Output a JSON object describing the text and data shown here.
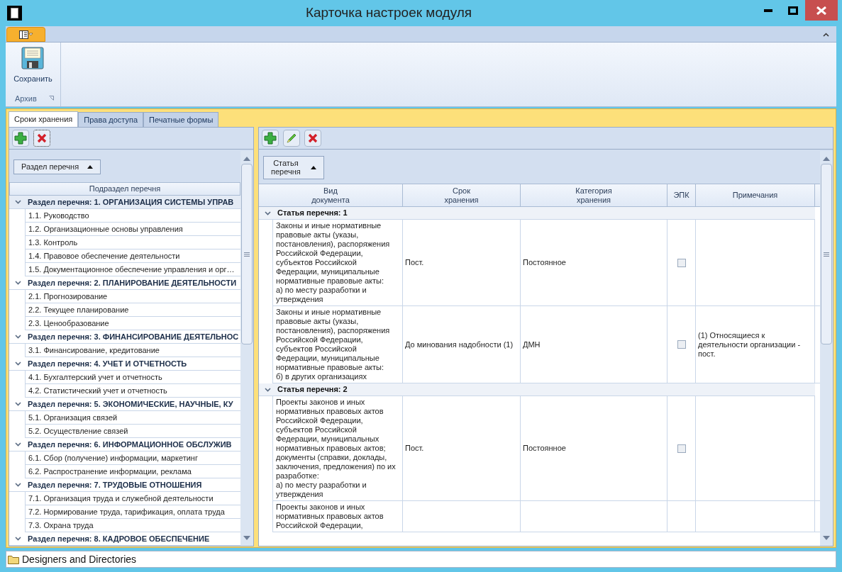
{
  "window": {
    "title": "Карточка настроек модуля"
  },
  "ribbon": {
    "groups": [
      {
        "label": "Архив",
        "buttons": [
          {
            "label": "Сохранить"
          }
        ]
      }
    ]
  },
  "tabs": [
    {
      "label": "Сроки хранения",
      "selected": true
    },
    {
      "label": "Права доступа",
      "selected": false
    },
    {
      "label": "Печатные формы",
      "selected": false
    }
  ],
  "left_panel": {
    "group_by": "Раздел перечня",
    "column": "Подраздел перечня",
    "groups": [
      {
        "label": "Раздел перечня: 1. ОРГАНИЗАЦИЯ СИСТЕМЫ УПРАВ",
        "expanded": true,
        "children": [
          {
            "label": "1.1. Руководство"
          },
          {
            "label": "1.2. Организационные основы управления"
          },
          {
            "label": "1.3. Контроль"
          },
          {
            "label": "1.4. Правовое обеспечение деятельности"
          },
          {
            "label": "1.5. Документационное обеспечение управления и орг…"
          }
        ]
      },
      {
        "label": "Раздел перечня: 2. ПЛАНИРОВАНИЕ ДЕЯТЕЛЬНОСТИ",
        "expanded": true,
        "children": [
          {
            "label": "2.1. Прогнозирование"
          },
          {
            "label": "2.2. Текущее планирование"
          },
          {
            "label": "2.3. Ценообразование"
          }
        ]
      },
      {
        "label": "Раздел перечня: 3. ФИНАНСИРОВАНИЕ ДЕЯТЕЛЬНОС",
        "expanded": true,
        "children": [
          {
            "label": "3.1. Финансирование, кредитование"
          }
        ]
      },
      {
        "label": "Раздел перечня: 4. УЧЕТ И ОТЧЕТНОСТЬ",
        "expanded": true,
        "children": [
          {
            "label": "4.1. Бухгалтерский учет и отчетность"
          },
          {
            "label": "4.2. Статистический учет и отчетность"
          }
        ]
      },
      {
        "label": "Раздел перечня: 5. ЭКОНОМИЧЕСКИЕ, НАУЧНЫЕ, КУ",
        "expanded": true,
        "children": [
          {
            "label": "5.1. Организация связей"
          },
          {
            "label": "5.2. Осуществление связей"
          }
        ]
      },
      {
        "label": "Раздел перечня: 6. ИНФОРМАЦИОННОЕ ОБСЛУЖИВ",
        "expanded": true,
        "children": [
          {
            "label": "6.1. Сбор (получение) информации, маркетинг"
          },
          {
            "label": "6.2. Распространение информации, реклама"
          }
        ]
      },
      {
        "label": "Раздел перечня: 7. ТРУДОВЫЕ ОТНОШЕНИЯ",
        "expanded": true,
        "children": [
          {
            "label": "7.1. Организация труда и служебной деятельности"
          },
          {
            "label": "7.2. Нормирование труда, тарификация, оплата труда"
          },
          {
            "label": "7.3. Охрана труда"
          }
        ]
      },
      {
        "label": "Раздел перечня: 8. КАДРОВОЕ ОБЕСПЕЧЕНИЕ",
        "expanded": true
      }
    ]
  },
  "right_panel": {
    "group_by": "Статья\nперечня",
    "columns": [
      "Вид\nдокумента",
      "Срок\nхранения",
      "Категория\nхранения",
      "ЭПК",
      "Примечания"
    ],
    "groups": [
      {
        "label": "Статья перечня: 1",
        "expanded": true,
        "rows": [
          {
            "document": "Законы и иные нормативные\nправовые акты (указы,\nпостановления), распоряжения\nРоссийской Федерации,\nсубъектов Российской\nФедерации, муниципальные\nнормативные правовые акты:\nа) по месту разработки и\nутверждения",
            "term": "Пост.",
            "category": "Постоянное",
            "epk_checked": false
          },
          {
            "document": "Законы и иные нормативные\nправовые акты (указы,\nпостановления), распоряжения\nРоссийской Федерации,\nсубъектов Российской\nФедерации, муниципальные\nнормативные правовые акты:\nб) в других организациях",
            "term": "До минования надобности (1)",
            "category": "ДМН",
            "epk_checked": false,
            "notes": "(1) Относящиеся к\nдеятельности организации -\nпост."
          }
        ]
      },
      {
        "label": "Статья перечня: 2",
        "expanded": true,
        "rows": [
          {
            "document": "Проекты законов и иных\nнормативных правовых актов\nРоссийской Федерации,\nсубъектов Российской\nФедерации, муниципальных\nнормативных правовых актов;\nдокументы (справки, доклады,\nзаключения, предложения) по их\nразработке:\nа) по месту разработки и\nутверждения",
            "term": "Пост.",
            "category": "Постоянное",
            "epk_checked": false
          },
          {
            "document": "Проекты законов и иных\nнормативных правовых актов\nРоссийской Федерации,"
          }
        ]
      }
    ]
  },
  "status_bar": {
    "label": "Designers and Directories"
  }
}
